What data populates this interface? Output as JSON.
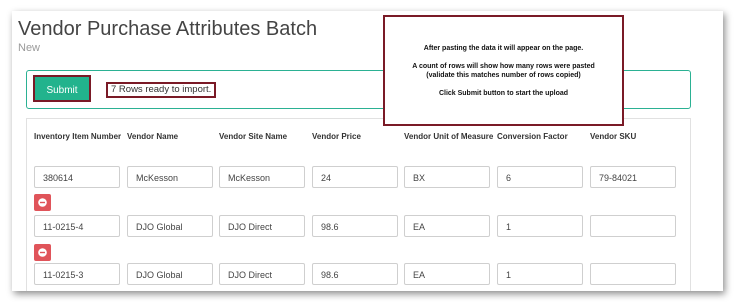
{
  "page": {
    "title": "Vendor Purchase Attributes Batch",
    "subtitle": "New"
  },
  "submit": {
    "button_label": "Submit",
    "status_text": "7 Rows ready to import."
  },
  "columns": [
    "Inventory Item Number",
    "Vendor Name",
    "Vendor Site Name",
    "Vendor Price",
    "Vendor Unit of Measure",
    "Conversion Factor",
    "Vendor SKU"
  ],
  "rows": [
    [
      "380614",
      "McKesson",
      "McKesson",
      "24",
      "BX",
      "6",
      "79-84021"
    ],
    [
      "11-0215-4",
      "DJO Global",
      "DJO Direct",
      "98.6",
      "EA",
      "1",
      ""
    ],
    [
      "11-0215-3",
      "DJO Global",
      "DJO Direct",
      "98.6",
      "EA",
      "1",
      ""
    ]
  ],
  "callout": {
    "line1": "After pasting the data it will appear on the page.",
    "line2": "A count of rows will show how many rows were pasted",
    "line3": "(validate this matches number of rows copied)",
    "line4": "Click Submit button to start the upload"
  },
  "colors": {
    "submit_green": "#22b38d",
    "panel_border": "#2bb193",
    "highlight_border": "#7a1a26",
    "remove_red": "#e0545a"
  },
  "icons": {
    "remove": "minus-circle-icon"
  }
}
